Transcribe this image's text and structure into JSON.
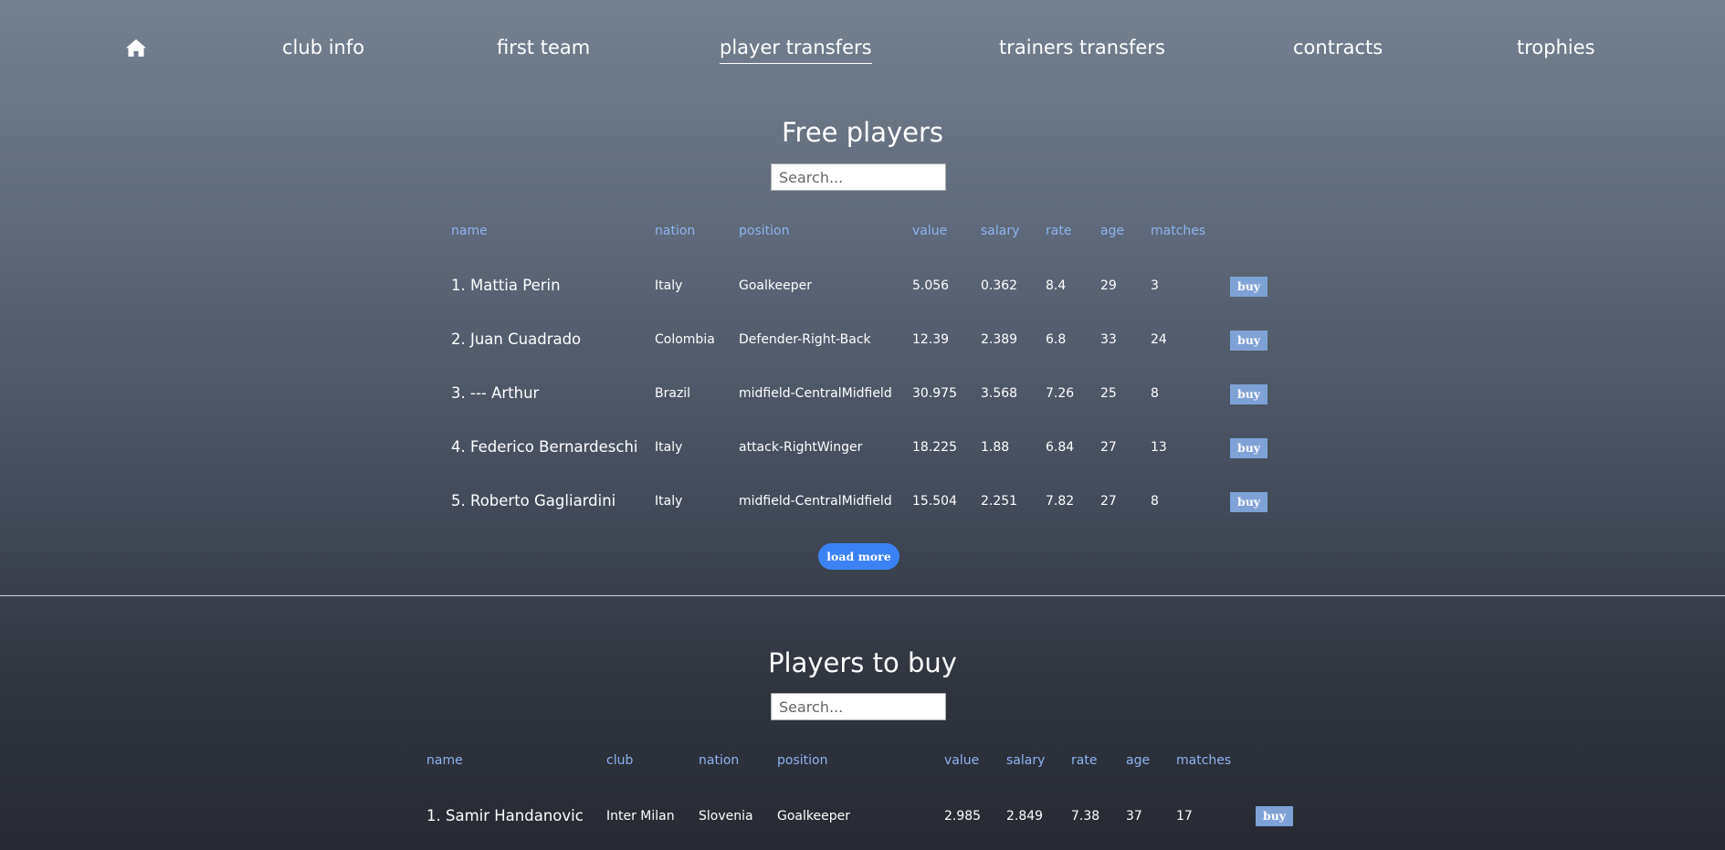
{
  "nav": {
    "home_icon": "home-icon",
    "items": [
      {
        "label": "club info",
        "active": false
      },
      {
        "label": "first team",
        "active": false
      },
      {
        "label": "player transfers",
        "active": true
      },
      {
        "label": "trainers transfers",
        "active": false
      },
      {
        "label": "contracts",
        "active": false
      },
      {
        "label": "trophies",
        "active": false
      }
    ]
  },
  "free_players": {
    "title": "Free players",
    "search_placeholder": "Search...",
    "headers": [
      "name",
      "nation",
      "position",
      "value",
      "salary",
      "rate",
      "age",
      "matches"
    ],
    "rows": [
      {
        "name": "1. Mattia Perin",
        "nation": "Italy",
        "position": "Goalkeeper",
        "value": "5.056",
        "salary": "0.362",
        "rate": "8.4",
        "age": "29",
        "matches": "3",
        "action": "buy"
      },
      {
        "name": "2. Juan Cuadrado",
        "nation": "Colombia",
        "position": "Defender-Right-Back",
        "value": "12.39",
        "salary": "2.389",
        "rate": "6.8",
        "age": "33",
        "matches": "24",
        "action": "buy"
      },
      {
        "name": "3. --- Arthur",
        "nation": "Brazil",
        "position": "midfield-CentralMidfield",
        "value": "30.975",
        "salary": "3.568",
        "rate": "7.26",
        "age": "25",
        "matches": "8",
        "action": "buy"
      },
      {
        "name": "4. Federico Bernardeschi",
        "nation": "Italy",
        "position": "attack-RightWinger",
        "value": "18.225",
        "salary": "1.88",
        "rate": "6.84",
        "age": "27",
        "matches": "13",
        "action": "buy"
      },
      {
        "name": "5. Roberto Gagliardini",
        "nation": "Italy",
        "position": "midfield-CentralMidfield",
        "value": "15.504",
        "salary": "2.251",
        "rate": "7.82",
        "age": "27",
        "matches": "8",
        "action": "buy"
      }
    ],
    "load_more_label": "load more"
  },
  "players_to_buy": {
    "title": "Players to buy",
    "search_placeholder": "Search...",
    "headers": [
      "name",
      "club",
      "nation",
      "position",
      "value",
      "salary",
      "rate",
      "age",
      "matches"
    ],
    "rows": [
      {
        "name": "1. Samir Handanovic",
        "club": "Inter Milan",
        "nation": "Slovenia",
        "position": "Goalkeeper",
        "value": "2.985",
        "salary": "2.849",
        "rate": "7.38",
        "age": "37",
        "matches": "17",
        "action": "buy"
      }
    ]
  },
  "colors": {
    "header_text": "#8fb4f0",
    "buy_button": "#7ea2d6",
    "load_more_button": "#3b82f6",
    "background_top": "#758190",
    "background_bottom": "#272a32"
  }
}
